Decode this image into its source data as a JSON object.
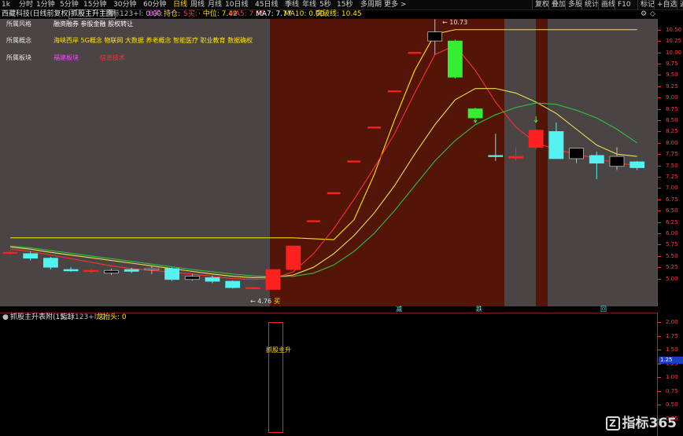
{
  "toolbar": {
    "items": [
      "1k",
      "分时",
      "1分钟",
      "5分钟",
      "15分钟",
      "30分钟",
      "60分钟",
      "日线",
      "周线",
      "月线",
      "10日线",
      "45日线",
      "季线",
      "年线",
      "5秒",
      "15秒",
      "多周期",
      "更多 >"
    ],
    "active": "日线",
    "right_items": [
      "复权",
      "叠加",
      "多股",
      "统计",
      "画线",
      "F10",
      "标记",
      "+自选",
      "返回"
    ]
  },
  "header": {
    "stock": "西藏科技(日线前复权)",
    "title": "抓股主升主图",
    "params": "指标123+l: 0.00",
    "b_label": "B买:",
    "sell_label": "持仓:",
    "s_label": "S买:",
    "zhongwei": "· 中位: 7.42",
    "ma5": "MA5: 7.55",
    "ma7": "MA7: 7.77",
    "ma10": "MA10: 0.00",
    "breakout": "突破线: 10.45"
  },
  "info": {
    "row1_label": "所属风格",
    "row1_value": "融资融券 参股金融 股权转让",
    "row2_label": "所属概念",
    "row2_value": "海峡西岸 5G概念 物联网 大数据 养老概念 智能医疗 职业教育 数据确权",
    "row3_label": "所属板块",
    "row3_v1": "福建板块",
    "row3_v2": "信息技术"
  },
  "price_labels": {
    "high": "10.73",
    "low": "4.76",
    "buy_marker": "买"
  },
  "sep_labels": [
    "减",
    "跌",
    "回"
  ],
  "y_axis": [
    "10.50",
    "10.25",
    "10.00",
    "9.75",
    "9.50",
    "9.25",
    "9.00",
    "8.75",
    "8.50",
    "8.25",
    "8.00",
    "7.75",
    "7.50",
    "7.25",
    "7.00",
    "6.75",
    "6.50",
    "6.25",
    "6.00",
    "5.75",
    "5.50",
    "5.25",
    "5.00"
  ],
  "indicator": {
    "title": "抓股主升表附(15,1)",
    "params": "指标123+l: 0",
    "signal": "龙抬头: 0",
    "box_label": "抓股主升",
    "y_axis": [
      "2.00",
      "1.75",
      "1.50",
      "1.25",
      "1.00",
      "0.75",
      "0.50",
      "0.25"
    ],
    "current_value": "1.25"
  },
  "watermark": "指标365",
  "colors": {
    "up": "#ff2020",
    "down": "#55f0f0",
    "green_candle": "#33ee33",
    "zone_dark": "#521508",
    "zone_gray": "#4a4444",
    "yellow": "#ffe600"
  },
  "chart_data": {
    "type": "candlestick",
    "ylim": [
      4.75,
      10.6
    ],
    "candles": [
      {
        "o": 5.58,
        "c": 5.58,
        "h": 5.62,
        "l": 5.54,
        "color": "red"
      },
      {
        "o": 5.55,
        "c": 5.45,
        "h": 5.6,
        "l": 5.4,
        "color": "cyan"
      },
      {
        "o": 5.45,
        "c": 5.25,
        "h": 5.48,
        "l": 5.2,
        "color": "cyan"
      },
      {
        "o": 5.2,
        "c": 5.17,
        "h": 5.25,
        "l": 5.15,
        "color": "cyan"
      },
      {
        "o": 5.18,
        "c": 5.18,
        "h": 5.22,
        "l": 5.12,
        "color": "red"
      },
      {
        "o": 5.12,
        "c": 5.18,
        "h": 5.22,
        "l": 5.08,
        "color": "black"
      },
      {
        "o": 5.2,
        "c": 5.16,
        "h": 5.24,
        "l": 5.12,
        "color": "cyan"
      },
      {
        "o": 5.2,
        "c": 5.22,
        "h": 5.28,
        "l": 5.1,
        "color": "black"
      },
      {
        "o": 5.22,
        "c": 4.98,
        "h": 5.25,
        "l": 4.95,
        "color": "cyan"
      },
      {
        "o": 5.05,
        "c": 4.98,
        "h": 5.1,
        "l": 4.95,
        "color": "black"
      },
      {
        "o": 5.02,
        "c": 4.94,
        "h": 5.06,
        "l": 4.9,
        "color": "cyan"
      },
      {
        "o": 4.94,
        "c": 4.8,
        "h": 4.96,
        "l": 4.78,
        "color": "cyan"
      },
      {
        "o": 4.8,
        "c": 4.78,
        "h": 4.82,
        "l": 4.76,
        "color": "red"
      },
      {
        "o": 4.76,
        "c": 5.2,
        "h": 5.2,
        "l": 4.76,
        "color": "red"
      },
      {
        "o": 5.2,
        "c": 5.72,
        "h": 5.72,
        "l": 5.2,
        "color": "red"
      },
      {
        "o": 6.28,
        "c": 6.28,
        "h": 6.28,
        "l": 6.28,
        "color": "red"
      },
      {
        "o": 6.9,
        "c": 6.9,
        "h": 6.9,
        "l": 6.9,
        "color": "red"
      },
      {
        "o": 7.6,
        "c": 7.6,
        "h": 7.6,
        "l": 7.6,
        "color": "red"
      },
      {
        "o": 8.35,
        "c": 8.35,
        "h": 8.35,
        "l": 8.35,
        "color": "red"
      },
      {
        "o": 9.15,
        "c": 9.15,
        "h": 9.15,
        "l": 9.15,
        "color": "red"
      },
      {
        "o": 10.0,
        "c": 10.0,
        "h": 10.0,
        "l": 10.0,
        "color": "red"
      },
      {
        "o": 10.45,
        "c": 10.25,
        "h": 10.73,
        "l": 9.95,
        "color": "black"
      },
      {
        "o": 10.25,
        "c": 9.45,
        "h": 10.28,
        "l": 9.42,
        "color": "green"
      },
      {
        "o": 8.75,
        "c": 8.55,
        "h": 8.78,
        "l": 8.55,
        "color": "green"
      },
      {
        "o": 7.72,
        "c": 7.72,
        "h": 8.2,
        "l": 7.6,
        "color": "cyan"
      },
      {
        "o": 7.7,
        "c": 7.66,
        "h": 7.9,
        "l": 7.6,
        "color": "red"
      },
      {
        "o": 8.28,
        "c": 7.9,
        "h": 8.3,
        "l": 7.85,
        "color": "red"
      },
      {
        "o": 8.25,
        "c": 7.65,
        "h": 8.45,
        "l": 7.65,
        "color": "cyan"
      },
      {
        "o": 7.88,
        "c": 7.65,
        "h": 7.88,
        "l": 7.55,
        "color": "black"
      },
      {
        "o": 7.72,
        "c": 7.55,
        "h": 7.8,
        "l": 7.2,
        "color": "cyan"
      },
      {
        "o": 7.7,
        "c": 7.48,
        "h": 7.9,
        "l": 7.4,
        "color": "black"
      },
      {
        "o": 7.58,
        "c": 7.45,
        "h": 7.6,
        "l": 7.4,
        "color": "cyan"
      }
    ],
    "series": [
      {
        "color": "#ffe600",
        "values": [
          5.9,
          5.9,
          5.9,
          5.9,
          5.9,
          5.9,
          5.9,
          5.9,
          5.9,
          5.9,
          5.9,
          5.9,
          5.9,
          5.9,
          5.9,
          5.88,
          5.86,
          6.3,
          7.3,
          8.5,
          9.6,
          10.4,
          10.5,
          10.5,
          10.5,
          10.5,
          10.5,
          10.5,
          10.5,
          10.5,
          10.5,
          10.5
        ]
      },
      {
        "color": "#ff3030",
        "values": [
          5.65,
          5.6,
          5.52,
          5.44,
          5.36,
          5.28,
          5.22,
          5.18,
          5.14,
          5.1,
          5.05,
          5.0,
          4.98,
          5.0,
          5.15,
          5.55,
          6.1,
          6.75,
          7.45,
          8.2,
          9.1,
          9.95,
          10.15,
          9.6,
          8.9,
          8.35,
          8.0,
          7.85,
          7.75,
          7.65,
          7.55,
          7.5
        ]
      },
      {
        "color": "#e8e050",
        "values": [
          5.7,
          5.65,
          5.58,
          5.52,
          5.46,
          5.4,
          5.34,
          5.28,
          5.22,
          5.16,
          5.1,
          5.05,
          5.02,
          5.03,
          5.08,
          5.25,
          5.55,
          5.95,
          6.45,
          7.05,
          7.75,
          8.4,
          8.95,
          9.2,
          9.2,
          9.1,
          8.9,
          8.65,
          8.3,
          7.95,
          7.75,
          7.7
        ]
      },
      {
        "color": "#30c040",
        "values": [
          5.72,
          5.68,
          5.62,
          5.56,
          5.5,
          5.44,
          5.38,
          5.32,
          5.26,
          5.2,
          5.15,
          5.1,
          5.06,
          5.04,
          5.05,
          5.12,
          5.3,
          5.6,
          6.0,
          6.5,
          7.05,
          7.6,
          8.05,
          8.4,
          8.62,
          8.78,
          8.88,
          8.85,
          8.72,
          8.55,
          8.3,
          8.0
        ]
      }
    ]
  }
}
